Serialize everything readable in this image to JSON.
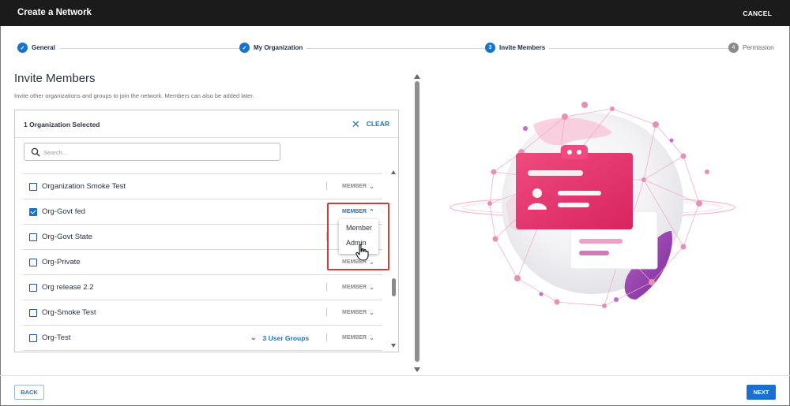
{
  "header": {
    "title": "Create a Network",
    "cancel_label": "CANCEL"
  },
  "stepper": {
    "steps": [
      {
        "label": "General",
        "marker": "✓"
      },
      {
        "label": "My Organization",
        "marker": "✓"
      },
      {
        "label": "Invite Members",
        "marker": "3"
      },
      {
        "label": "Permission",
        "marker": "4"
      }
    ]
  },
  "page": {
    "title": "Invite Members",
    "description": "Invite other organizations and groups to join the network. Members can also be added later."
  },
  "panel": {
    "selected_text": "1 Organization Selected",
    "clear_label": "CLEAR",
    "search_placeholder": "Search..."
  },
  "organizations": [
    {
      "name": "Organization Smoke Test",
      "role": "MEMBER",
      "checked": false
    },
    {
      "name": "Org-Govt fed",
      "role": "MEMBER",
      "checked": true
    },
    {
      "name": "Org-Govt State",
      "role": "MEMBER",
      "checked": false
    },
    {
      "name": "Org-Private",
      "role": "MEMBER",
      "checked": false
    },
    {
      "name": "Org release 2.2",
      "role": "MEMBER",
      "checked": false
    },
    {
      "name": "Org-Smoke Test",
      "role": "MEMBER",
      "checked": false
    },
    {
      "name": "Org-Test",
      "role": "MEMBER",
      "checked": false,
      "groups": "3 User Groups"
    }
  ],
  "role_dropdown": {
    "options": [
      "Member",
      "Admin"
    ]
  },
  "footer": {
    "back_label": "BACK",
    "next_label": "NEXT"
  },
  "colors": {
    "accent": "#1a73c8",
    "header_bg": "#1b1b1b",
    "highlight": "#d43b3b",
    "illustration_pink": "#e8336e"
  }
}
